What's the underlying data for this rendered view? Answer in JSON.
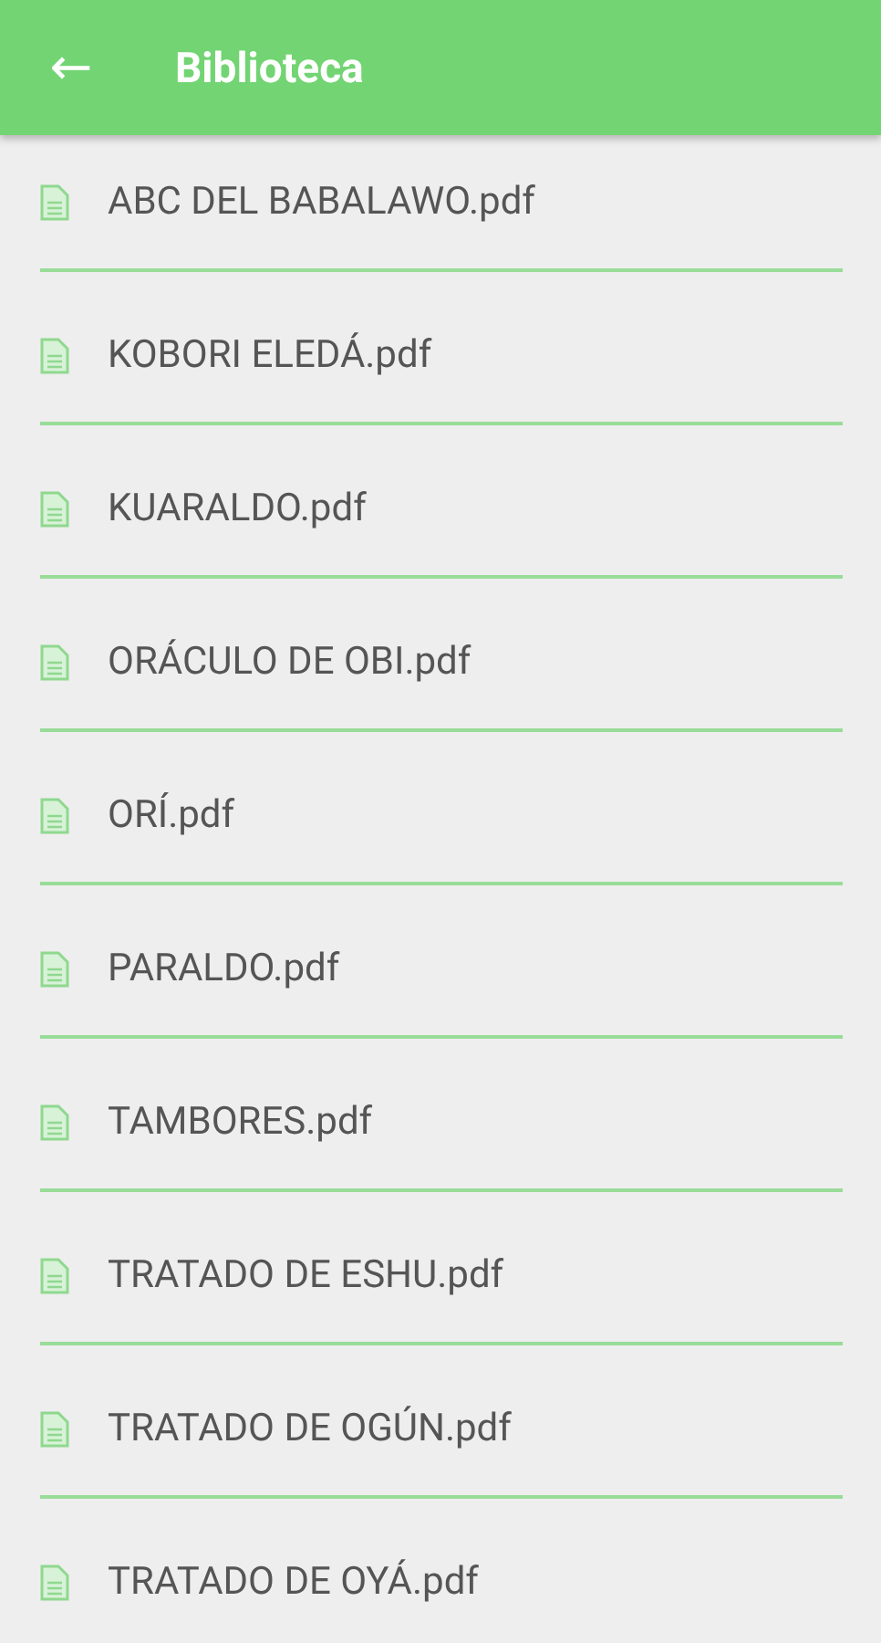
{
  "app_bar": {
    "back": "←",
    "title": "Biblioteca"
  },
  "files": [
    {
      "name": "ABC DEL BABALAWO.pdf"
    },
    {
      "name": "KOBORI ELEDÁ.pdf"
    },
    {
      "name": "KUARALDO.pdf"
    },
    {
      "name": "ORÁCULO DE OBI.pdf"
    },
    {
      "name": "ORÍ.pdf"
    },
    {
      "name": "PARALDO.pdf"
    },
    {
      "name": "TAMBORES.pdf"
    },
    {
      "name": "TRATADO DE ESHU.pdf"
    },
    {
      "name": "TRATADO DE OGÚN.pdf"
    },
    {
      "name": "TRATADO DE OYÁ.pdf"
    }
  ]
}
